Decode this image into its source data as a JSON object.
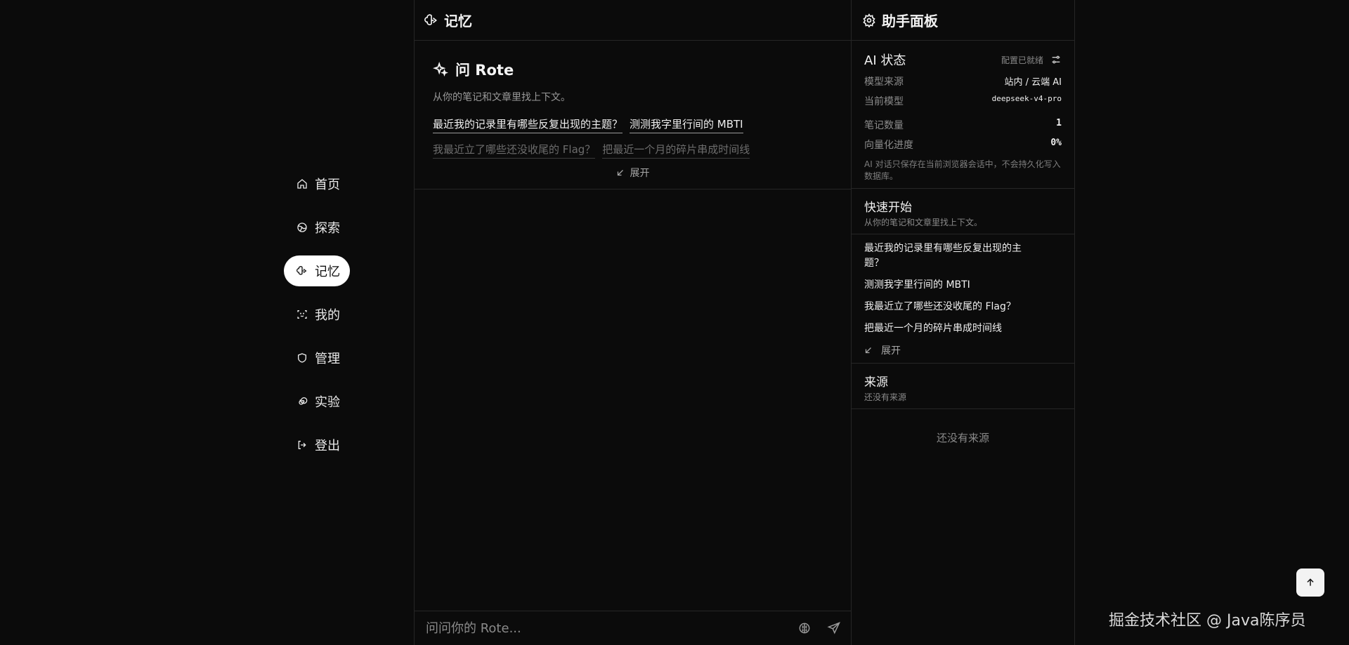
{
  "nav": {
    "items": [
      {
        "label": "首页",
        "icon": "home-icon"
      },
      {
        "label": "探索",
        "icon": "globe-icon"
      },
      {
        "label": "记忆",
        "icon": "brain-icon",
        "active": true
      },
      {
        "label": "我的",
        "icon": "scan-face-icon"
      },
      {
        "label": "管理",
        "icon": "shield-icon"
      },
      {
        "label": "实验",
        "icon": "spiral-icon"
      },
      {
        "label": "登出",
        "icon": "logout-icon"
      }
    ]
  },
  "center": {
    "title": "记忆",
    "ask": {
      "title": "问 Rote",
      "subtitle": "从你的笔记和文章里找上下文。",
      "suggestions": [
        "最近我的记录里有哪些反复出现的主题？",
        "测测我字里行间的 MBTI",
        "我最近立了哪些还没收尾的 Flag？",
        "把最近一个月的碎片串成时间线"
      ],
      "expand_label": "展开"
    },
    "input_placeholder": "问问你的 Rote..."
  },
  "panel": {
    "title": "助手面板",
    "ai_status": {
      "title": "AI 状态",
      "ready_label": "配置已就绪",
      "model_source_label": "模型来源",
      "model_source_value": "站内 / 云端 AI",
      "current_model_label": "当前模型",
      "current_model_value": "deepseek-v4-pro",
      "note_count_label": "笔记数量",
      "note_count_value": "1",
      "vector_progress_label": "向量化进度",
      "vector_progress_value": "0%",
      "note": "AI 对话只保存在当前浏览器会话中，不会持久化写入数据库。"
    },
    "quick_start": {
      "title": "快速开始",
      "subtitle": "从你的笔记和文章里找上下文。",
      "items": [
        "最近我的记录里有哪些反复出现的主题？",
        "测测我字里行间的 MBTI",
        "我最近立了哪些还没收尾的 Flag？",
        "把最近一个月的碎片串成时间线"
      ],
      "expand_label": "展开"
    },
    "sources": {
      "title": "来源",
      "subtitle": "还没有来源",
      "empty": "还没有来源"
    }
  },
  "watermark": "掘金技术社区 @ Java陈序员"
}
